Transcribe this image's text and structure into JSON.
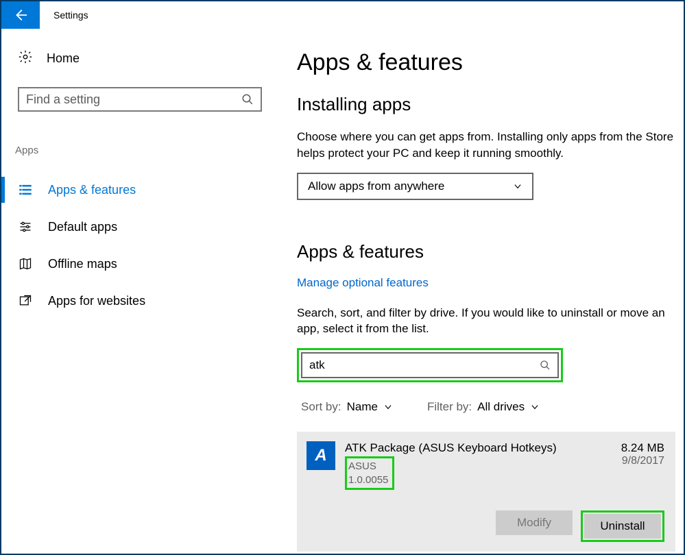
{
  "title_bar": {
    "title": "Settings"
  },
  "sidebar": {
    "home": "Home",
    "search_placeholder": "Find a setting",
    "category": "Apps",
    "items": [
      {
        "label": "Apps & features"
      },
      {
        "label": "Default apps"
      },
      {
        "label": "Offline maps"
      },
      {
        "label": "Apps for websites"
      }
    ]
  },
  "main": {
    "page_title": "Apps & features",
    "installing": {
      "title": "Installing apps",
      "desc": "Choose where you can get apps from. Installing only apps from the Store helps protect your PC and keep it running smoothly.",
      "dropdown": "Allow apps from anywhere"
    },
    "apps_section": {
      "title": "Apps & features",
      "link": "Manage optional features",
      "desc": "Search, sort, and filter by drive. If you would like to uninstall or move an app, select it from the list.",
      "search_value": "atk",
      "sort_label": "Sort by:",
      "sort_value": "Name",
      "filter_label": "Filter by:",
      "filter_value": "All drives"
    },
    "app": {
      "icon_letter": "A",
      "name": "ATK Package (ASUS Keyboard Hotkeys)",
      "publisher": "ASUS",
      "version": "1.0.0055",
      "size": "8.24 MB",
      "date": "9/8/2017",
      "modify_label": "Modify",
      "uninstall_label": "Uninstall"
    }
  }
}
